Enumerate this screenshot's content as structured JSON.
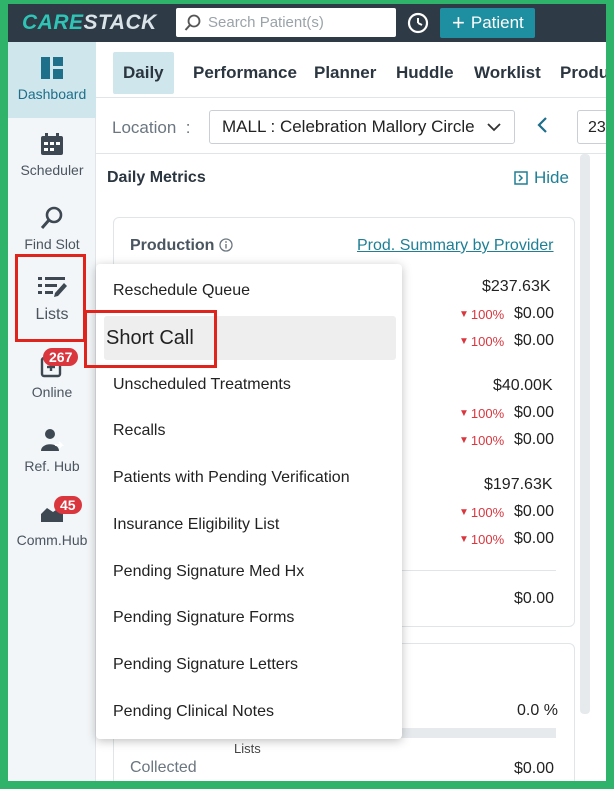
{
  "app": {
    "logo_left": "CARE",
    "logo_right": "STACK"
  },
  "search": {
    "placeholder": "Search Patient(s)"
  },
  "patient_button": {
    "plus": "+",
    "label": "Patient"
  },
  "nav": {
    "items": [
      {
        "label": "Dashboard",
        "icon": "dashboard-icon"
      },
      {
        "label": "Scheduler",
        "icon": "calendar-icon"
      },
      {
        "label": "Find Slot",
        "icon": "search-icon"
      },
      {
        "label": "Lists",
        "icon": "list-edit-icon"
      },
      {
        "label": "Online",
        "icon": "online-icon",
        "badge": "267"
      },
      {
        "label": "Ref. Hub",
        "icon": "referral-icon"
      },
      {
        "label": "Comm.Hub",
        "icon": "communication-icon",
        "badge": "45"
      }
    ]
  },
  "tabs": [
    "Daily",
    "Performance",
    "Planner",
    "Huddle",
    "Worklist",
    "Production"
  ],
  "location": {
    "label": "Location",
    "colon": ":",
    "value": "MALL : Celebration Mallory Circle",
    "date_partial": "23"
  },
  "metrics": {
    "title": "Daily Metrics",
    "hide_label": "Hide",
    "production_title": "Production",
    "prod_link": "Prod. Summary by Provider",
    "rows": [
      {
        "total": "$237.63K",
        "pct1": "100%",
        "v1": "$0.00",
        "pct2": "100%",
        "v2": "$0.00"
      },
      {
        "total": "$40.00K",
        "pct1": "100%",
        "v1": "$0.00",
        "pct2": "100%",
        "v2": "$0.00"
      },
      {
        "total": "$197.63K",
        "pct1": "100%",
        "v1": "$0.00",
        "pct2": "100%",
        "v2": "$0.00"
      }
    ],
    "bottom_value": "$0.00",
    "percent_value": "0.0 %",
    "collected_label": "Collected",
    "collected_value": "$0.00"
  },
  "lists_menu": {
    "items": [
      "Reschedule Queue",
      "Short Call",
      "Unscheduled Treatments",
      "Recalls",
      "Patients with Pending Verification",
      "Insurance Eligibility List",
      "Pending Signature Med Hx",
      "Pending Signature Forms",
      "Pending Signature Letters",
      "Pending Clinical Notes"
    ],
    "tooltip": "Lists"
  },
  "colors": {
    "accent": "#1e8fa0",
    "topbar": "#2e3a45",
    "badge": "#d9363e",
    "highlight": "#e0241b",
    "frame": "#2fb36a"
  }
}
